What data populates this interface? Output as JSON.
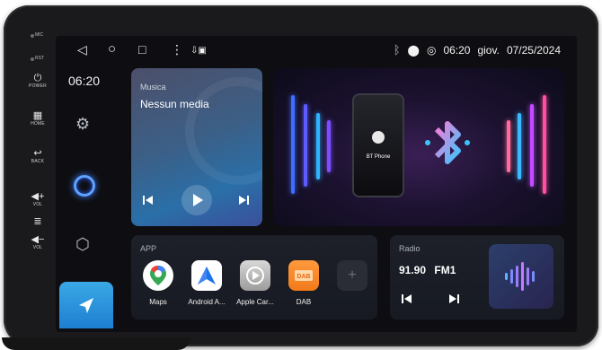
{
  "bezel": {
    "mic_label": "MIC",
    "rst_label": "RST",
    "power_label": "POWER",
    "home_label": "HOME",
    "back_label": "BACK",
    "vol_up_label": "VOL",
    "vol_down_label": "VOL"
  },
  "status_bar": {
    "time": "06:20",
    "day": "giov.",
    "date": "07/25/2024"
  },
  "rail": {
    "time": "06:20"
  },
  "music": {
    "title": "Musica",
    "status": "Nessun media"
  },
  "bluetooth": {
    "phone_label": "BT Phone"
  },
  "apps": {
    "title": "APP",
    "items": [
      {
        "label": "Maps"
      },
      {
        "label": "Android A..."
      },
      {
        "label": "Apple Car..."
      },
      {
        "label": "DAB"
      }
    ],
    "add_label": "+"
  },
  "radio": {
    "title": "Radio",
    "frequency": "91.90",
    "band": "FM1"
  },
  "colors": {
    "accent_blue": "#1e7fd1",
    "music_card": "#2a6fa8",
    "bluetooth_glow": "#6c5bff"
  }
}
